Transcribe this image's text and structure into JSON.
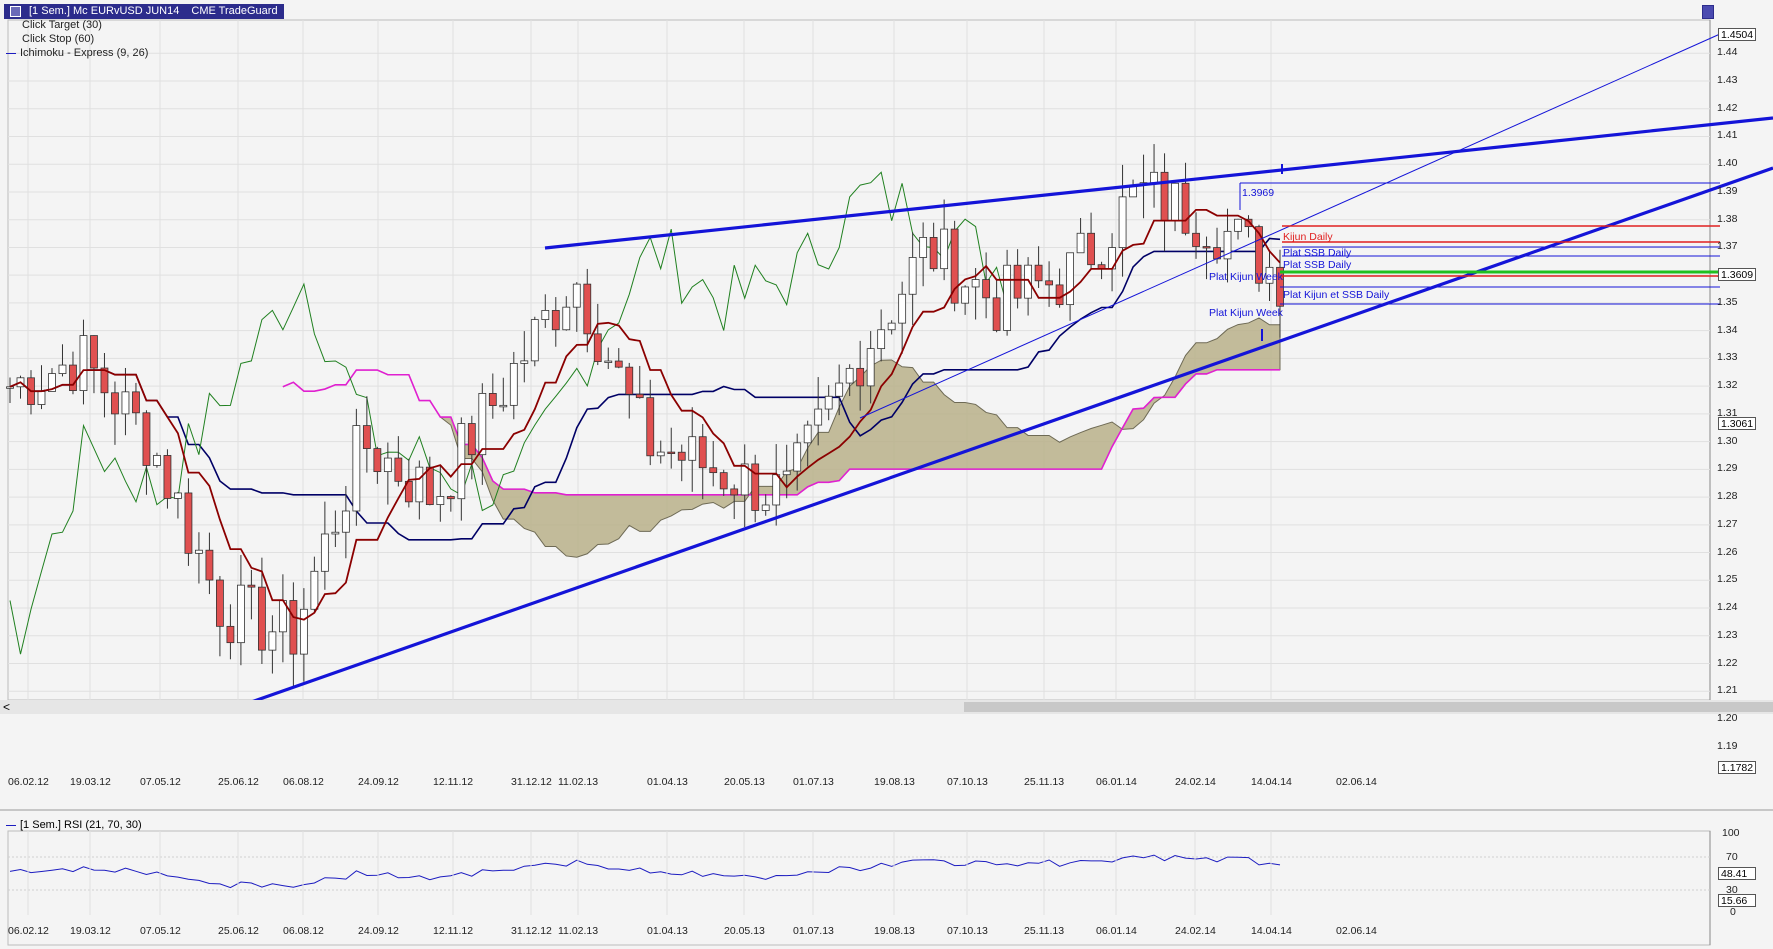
{
  "window": {
    "title_main": "[1 Sem.] Mc EURvUSD JUN14",
    "title_source": "CME TradeGuard"
  },
  "legend": [
    {
      "label": "Click Target  (30)"
    },
    {
      "label": "Click Stop  (60)"
    },
    {
      "label": "Ichimoku - Express  (9, 26)"
    }
  ],
  "price_axis": {
    "ticks": [
      "1.44",
      "1.43",
      "1.42",
      "1.41",
      "1.40",
      "1.39",
      "1.38",
      "1.37",
      "1.36",
      "1.35",
      "1.34",
      "1.33",
      "1.32",
      "1.31",
      "1.30",
      "1.29",
      "1.28",
      "1.27",
      "1.26",
      "1.25",
      "1.24",
      "1.23",
      "1.22",
      "1.21",
      "1.20",
      "1.19"
    ],
    "tags": [
      "1.4504",
      "1.3609",
      "1.3061",
      "1.1782"
    ]
  },
  "x_axis": {
    "labels": [
      "06.02.12",
      "19.03.12",
      "07.05.12",
      "25.06.12",
      "06.08.12",
      "24.09.12",
      "12.11.12",
      "31.12.12",
      "11.02.13",
      "01.04.13",
      "20.05.13",
      "01.07.13",
      "19.08.13",
      "07.10.13",
      "25.11.13",
      "06.01.14",
      "24.02.14",
      "14.04.14",
      "02.06.14"
    ]
  },
  "annotations": {
    "peak_value": "1.3969",
    "kijun_daily": "Kijun Daily",
    "plat_ssb_daily_1": "Plat SSB Daily",
    "plat_ssb_daily_2": "Plat SSB Daily",
    "plat_kijun_week_1": "Plat Kijun Week",
    "plat_kijun_ssb_daily": "Plat Kijun et SSB Daily",
    "plat_kijun_week_2": "Plat Kijun Week"
  },
  "rsi": {
    "header": "[1 Sem.] RSI  (21, 70, 30)",
    "ticks": [
      "100",
      "70",
      "30",
      "0"
    ],
    "tags": [
      "48.41",
      "15.66"
    ]
  },
  "scroll_left_glyph": "<",
  "colors": {
    "title_bg": "#2c2c8c",
    "trend_blue": "#1414d8",
    "tenkan": "#8b0000",
    "kijun": "#000066",
    "chikou": "#208020",
    "ssb": "#e020d0",
    "cloud": "#b8b089",
    "bull": "#ffffff",
    "bear": "#e05050",
    "green_level": "#20c020",
    "red_level": "#e02020"
  },
  "chart_data": {
    "type": "candlestick",
    "title": "[1 Sem.] Mc EURvUSD JUN14",
    "ylim": [
      1.178,
      1.452
    ],
    "x": [
      "06.02.12",
      "19.03.12",
      "07.05.12",
      "25.06.12",
      "06.08.12",
      "24.09.12",
      "12.11.12",
      "31.12.12",
      "11.02.13",
      "01.04.13",
      "20.05.13",
      "01.07.13",
      "19.08.13",
      "07.10.13",
      "25.11.13",
      "06.01.14",
      "24.02.14",
      "14.04.14",
      "02.06.14"
    ],
    "close_approx": [
      1.32,
      1.33,
      1.3,
      1.24,
      1.23,
      1.3,
      1.28,
      1.32,
      1.36,
      1.3,
      1.29,
      1.28,
      1.33,
      1.37,
      1.35,
      1.36,
      1.39,
      1.38,
      1.36
    ],
    "levels": [
      {
        "value": 1.3969,
        "label": "1.3969"
      },
      {
        "value": 1.3609,
        "label": "1.3609"
      },
      {
        "value": 1.3061,
        "label": "1.3061"
      }
    ],
    "rsi": {
      "ylim": [
        0,
        100
      ],
      "last": 48.41,
      "low": 15.66
    }
  }
}
